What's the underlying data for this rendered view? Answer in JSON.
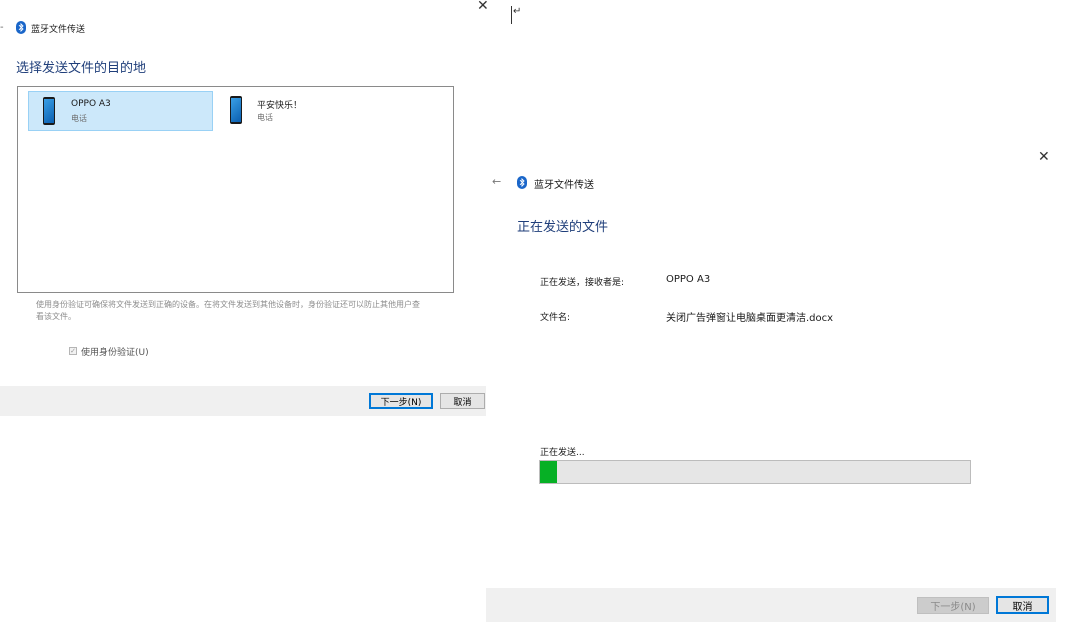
{
  "left_dialog": {
    "header": {
      "back_icon": "back-arrow-icon",
      "bt_icon": "bluetooth-icon",
      "title": "蓝牙文件传送"
    },
    "close_icon": "close-icon",
    "heading": "选择发送文件的目的地",
    "devices": [
      {
        "name": "OPPO A3",
        "type": "电话",
        "icon": "phone-icon",
        "selected": true
      },
      {
        "name": "平安快乐！",
        "type": "电话",
        "icon": "phone-icon",
        "selected": false
      }
    ],
    "note": "使用身份验证可确保将文件发送到正确的设备。在将文件发送到其他设备时，身份验证还可以防止其他用户查看该文件。",
    "auth_checkbox": {
      "label": "使用身份验证(U)",
      "checked": true
    },
    "buttons": {
      "next": "下一步(N)",
      "cancel": "取消"
    }
  },
  "cursor_glyph": "↵",
  "right_dialog": {
    "header": {
      "back_icon": "back-arrow-icon",
      "bt_icon": "bluetooth-icon",
      "title": "蓝牙文件传送"
    },
    "close_icon": "close-icon",
    "heading": "正在发送的文件",
    "receiver_label": "正在发送，接收者是:",
    "receiver_value": "OPPO A3",
    "filename_label": "文件名:",
    "filename_value": "关闭广告弹窗让电脑桌面更清洁.docx",
    "status": "正在发送...",
    "progress_percent": 4,
    "buttons": {
      "next": "下一步(N)",
      "cancel": "取消"
    }
  },
  "colors": {
    "heading": "#1f3e7a",
    "selection": "#cce8fa",
    "progress": "#06b025",
    "bluetooth": "#1a66c9",
    "button_focus": "#0078d7"
  }
}
